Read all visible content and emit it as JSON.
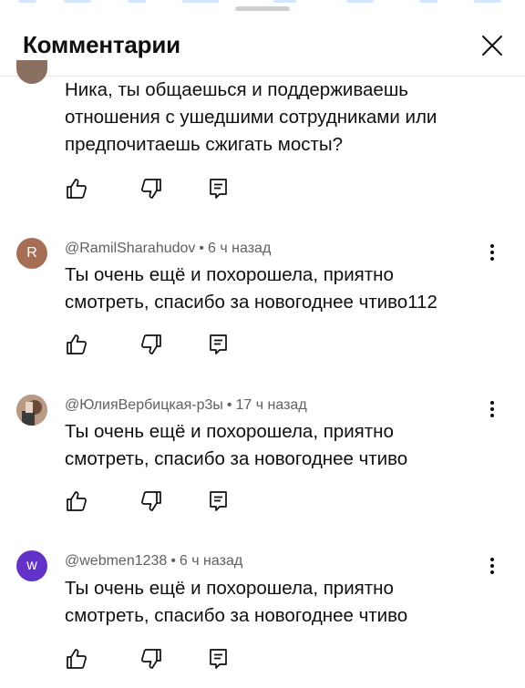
{
  "header": {
    "title": "Комментарии"
  },
  "comments": [
    {
      "author": "",
      "time": "",
      "lines": [
        "Ника, ты общаешься и поддерживаешь",
        "отношения с ушедшими сотрудниками или",
        "предпочитаешь сжигать мосты?"
      ]
    },
    {
      "author": "@RamilSharahudov",
      "time": "6 ч назад",
      "avatar_letter": "R",
      "lines": [
        "Ты очень ещё и похорошела, приятно",
        "смотреть, спасибо за новогоднее чтиво112"
      ]
    },
    {
      "author": "@ЮлияВербицкая-р3ы",
      "time": "17 ч назад",
      "lines": [
        "Ты очень ещё и похорошела, приятно",
        "смотреть, спасибо за новогоднее чтиво"
      ]
    },
    {
      "author": "@webmen1238",
      "time": "6 ч назад",
      "avatar_letter": "w",
      "lines": [
        "Ты очень ещё и похорошела, приятно",
        "смотреть, спасибо за новогоднее чтиво"
      ]
    }
  ],
  "icons": {
    "close": "close-icon",
    "like": "thumb-up-icon",
    "dislike": "thumb-down-icon",
    "reply": "reply-icon",
    "menu": "more-vertical-icon"
  },
  "colors": {
    "avatar_r": "#a66f55",
    "avatar_w": "#6332c9",
    "meta_text": "#606060",
    "body_text": "#0f0f0f"
  }
}
